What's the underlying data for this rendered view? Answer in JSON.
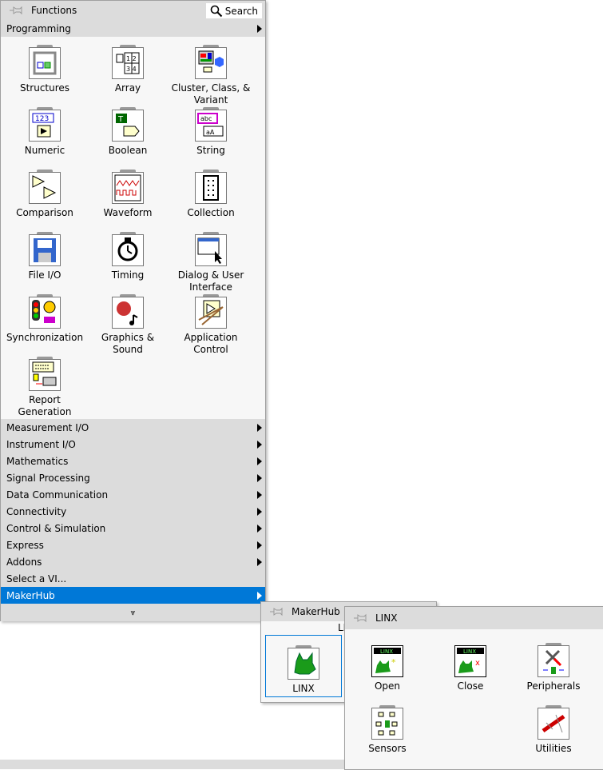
{
  "functions": {
    "title": "Functions",
    "search": "Search",
    "programming": "Programming",
    "items": [
      {
        "label": "Structures",
        "icon": "structures-icon"
      },
      {
        "label": "Array",
        "icon": "array-icon"
      },
      {
        "label": "Cluster, Class, & Variant",
        "icon": "cluster-icon"
      },
      {
        "label": "Numeric",
        "icon": "numeric-icon"
      },
      {
        "label": "Boolean",
        "icon": "boolean-icon"
      },
      {
        "label": "String",
        "icon": "string-icon"
      },
      {
        "label": "Comparison",
        "icon": "comparison-icon"
      },
      {
        "label": "Waveform",
        "icon": "waveform-icon"
      },
      {
        "label": "Collection",
        "icon": "collection-icon"
      },
      {
        "label": "File I/O",
        "icon": "file-io-icon"
      },
      {
        "label": "Timing",
        "icon": "timing-icon"
      },
      {
        "label": "Dialog & User Interface",
        "icon": "dialog-icon"
      },
      {
        "label": "Synchronization",
        "icon": "synchronization-icon"
      },
      {
        "label": "Graphics & Sound",
        "icon": "graphics-icon"
      },
      {
        "label": "Application Control",
        "icon": "app-control-icon"
      },
      {
        "label": "Report Generation",
        "icon": "report-icon"
      }
    ],
    "categories": [
      "Measurement I/O",
      "Instrument I/O",
      "Mathematics",
      "Signal Processing",
      "Data Communication",
      "Connectivity",
      "Control & Simulation",
      "Express",
      "Addons"
    ],
    "select_vi": "Select a VI...",
    "selected": "MakerHub",
    "accent": "#0078d7"
  },
  "makerhub": {
    "title": "MakerHub",
    "subtitle": "LINX",
    "item": "LINX"
  },
  "linx": {
    "title": "LINX",
    "items": [
      {
        "label": "Open"
      },
      {
        "label": "Close"
      },
      {
        "label": "Peripherals"
      },
      {
        "label": "Sensors"
      },
      {
        "label": "Utilities"
      }
    ]
  }
}
